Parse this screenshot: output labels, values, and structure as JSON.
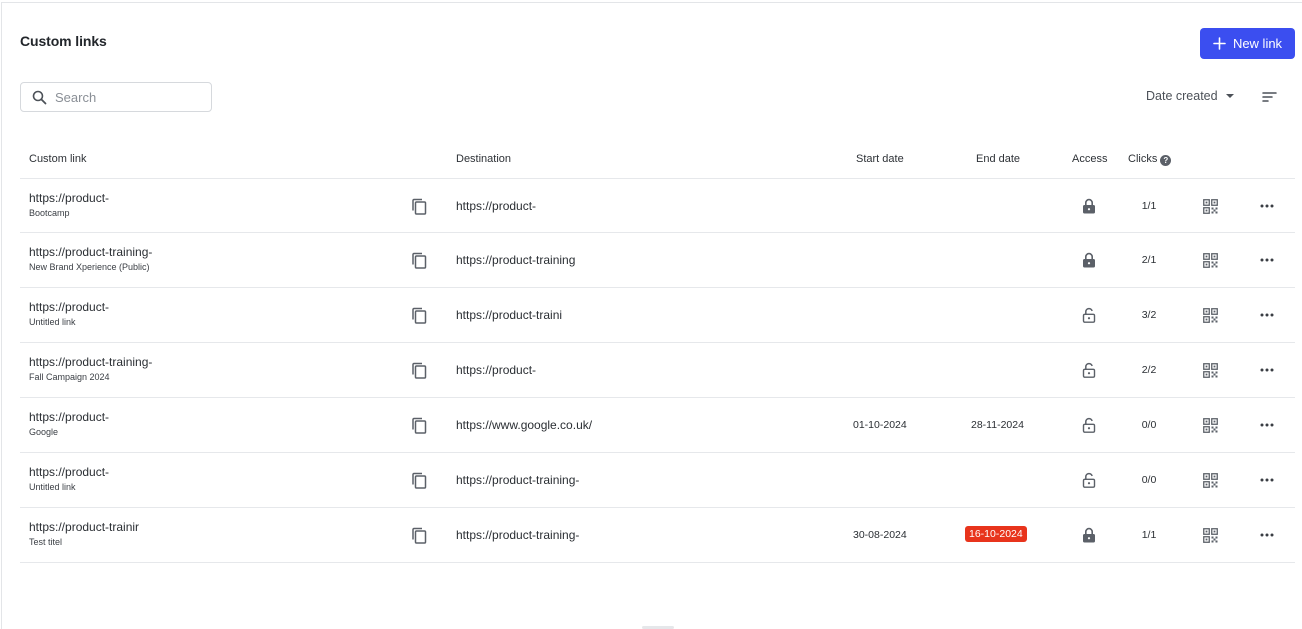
{
  "page": {
    "title": "Custom links"
  },
  "toolbar": {
    "new_link_label": "New link"
  },
  "search": {
    "placeholder": "Search"
  },
  "sort": {
    "label": "Date created"
  },
  "table": {
    "headers": {
      "custom_link": "Custom link",
      "destination": "Destination",
      "start_date": "Start date",
      "end_date": "End date",
      "access": "Access",
      "clicks": "Clicks",
      "clicks_help": "?"
    },
    "rows": [
      {
        "url": "https://product-",
        "title": "Bootcamp",
        "destination": "https://product-",
        "start_date": "",
        "end_date": "",
        "end_expired": false,
        "access": "locked",
        "clicks": "1/1"
      },
      {
        "url": "https://product-training-",
        "title": "New Brand Xperience (Public)",
        "destination": "https://product-training",
        "start_date": "",
        "end_date": "",
        "end_expired": false,
        "access": "locked",
        "clicks": "2/1"
      },
      {
        "url": "https://product-",
        "title": "Untitled link",
        "destination": "https://product-traini",
        "start_date": "",
        "end_date": "",
        "end_expired": false,
        "access": "unlocked",
        "clicks": "3/2"
      },
      {
        "url": "https://product-training-",
        "title": "Fall Campaign 2024",
        "destination": "https://product-",
        "start_date": "",
        "end_date": "",
        "end_expired": false,
        "access": "unlocked",
        "clicks": "2/2"
      },
      {
        "url": "https://product-",
        "title": "Google",
        "destination": "https://www.google.co.uk/",
        "start_date": "01-10-2024",
        "end_date": "28-11-2024",
        "end_expired": false,
        "access": "unlocked",
        "clicks": "0/0"
      },
      {
        "url": "https://product-",
        "title": "Untitled link",
        "destination": "https://product-training-",
        "start_date": "",
        "end_date": "",
        "end_expired": false,
        "access": "unlocked",
        "clicks": "0/0"
      },
      {
        "url": "https://product-trainir",
        "title": "Test titel",
        "destination": "https://product-training-",
        "start_date": "30-08-2024",
        "end_date": "16-10-2024",
        "end_expired": true,
        "access": "locked",
        "clicks": "1/1"
      }
    ]
  },
  "icons": {
    "add": "plus-icon",
    "search": "search-icon",
    "sort_caret": "caret-down-icon",
    "filter": "filter-lines-icon",
    "copy": "copy-icon",
    "access_locked": "lock-closed-icon",
    "access_unlocked": "lock-open-icon",
    "qr": "qr-code-icon",
    "more": "more-horizontal-icon"
  },
  "colors": {
    "accent": "#3b4ef0",
    "expired_badge": "#e8341c",
    "icon": "#5b6068"
  }
}
